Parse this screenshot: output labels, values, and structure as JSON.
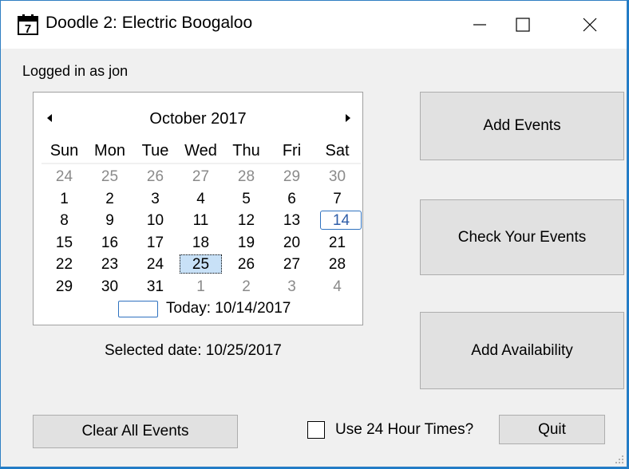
{
  "window": {
    "title": "Doodle 2: Electric Boogaloo",
    "icon_text": "7"
  },
  "status": {
    "logged_in": "Logged in as jon"
  },
  "calendar": {
    "month_title": "October 2017",
    "weekdays": [
      "Sun",
      "Mon",
      "Tue",
      "Wed",
      "Thu",
      "Fri",
      "Sat"
    ],
    "weeks": [
      [
        "24",
        "25",
        "26",
        "27",
        "28",
        "29",
        "30"
      ],
      [
        "1",
        "2",
        "3",
        "4",
        "5",
        "6",
        "7"
      ],
      [
        "8",
        "9",
        "10",
        "11",
        "12",
        "13",
        "14"
      ],
      [
        "15",
        "16",
        "17",
        "18",
        "19",
        "20",
        "21"
      ],
      [
        "22",
        "23",
        "24",
        "25",
        "26",
        "27",
        "28"
      ],
      [
        "29",
        "30",
        "31",
        "1",
        "2",
        "3",
        "4"
      ]
    ],
    "today_label": "Today: 10/14/2017"
  },
  "selected_date": "Selected date: 10/25/2017",
  "buttons": {
    "add_events": "Add Events",
    "check_events": "Check Your Events",
    "add_availability": "Add Availability",
    "clear_all": "Clear All Events",
    "quit": "Quit"
  },
  "checkbox": {
    "label": "Use 24 Hour Times?",
    "checked": false
  },
  "colors": {
    "accent": "#2f72c0",
    "selection": "#c8e1f7",
    "window_border": "#2f7fc3"
  }
}
